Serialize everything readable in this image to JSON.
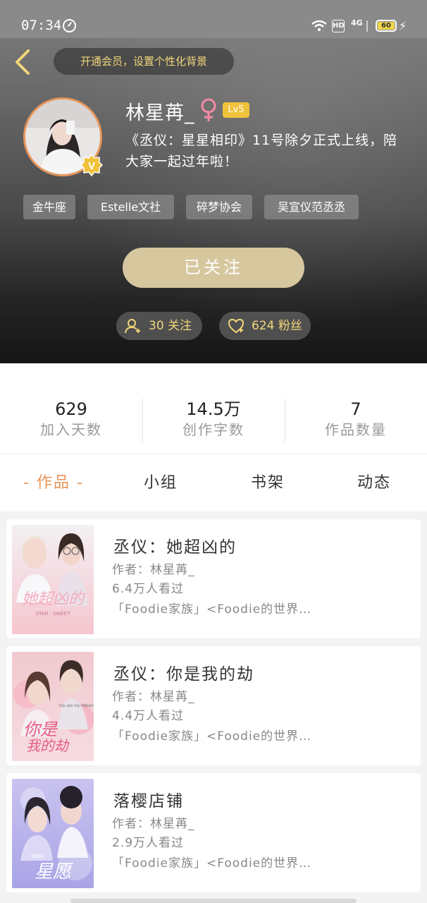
{
  "status_bar": {
    "time": "07:34",
    "battery": "60",
    "network": "4G",
    "hd": "HD"
  },
  "header": {
    "vip_banner": "开通会员，设置个性化背景",
    "username": "林星苒_",
    "gender_symbol": "♀",
    "level": "Lv5",
    "bio": "《丞仪：星星相印》11号除夕正式上线，陪大家一起过年啦！",
    "tags": [
      "金牛座",
      "Estelle文社",
      "碎梦协会",
      "吴宣仪范丞丞"
    ],
    "follow_label": "已关注",
    "following": "30 关注",
    "fans": "624 粉丝"
  },
  "stats": [
    {
      "value": "629",
      "label": "加入天数"
    },
    {
      "value": "14.5万",
      "label": "创作字数"
    },
    {
      "value": "7",
      "label": "作品数量"
    }
  ],
  "tabs": [
    {
      "label": "- 作品 -",
      "active": true
    },
    {
      "label": "小组",
      "active": false
    },
    {
      "label": "书架",
      "active": false
    },
    {
      "label": "动态",
      "active": false
    }
  ],
  "books": [
    {
      "title": "丞仪：她超凶的",
      "author": "作者：林星苒_",
      "views": "6.4万人看过",
      "group": "「Foodie家族」<Foodie的世界…"
    },
    {
      "title": "丞仪：你是我的劫",
      "author": "作者：林星苒_",
      "views": "4.4万人看过",
      "group": "「Foodie家族」<Foodie的世界…"
    },
    {
      "title": "落樱店铺",
      "author": "作者：林星苒_",
      "views": "2.9万人看过",
      "group": "「Foodie家族」<Foodie的世界…"
    }
  ],
  "colors": {
    "accent": "#e8955a",
    "gold": "#f1d579",
    "follow_button": "#d6c79f",
    "level_badge": "#f0c23c"
  }
}
